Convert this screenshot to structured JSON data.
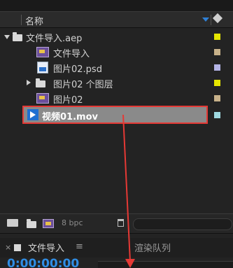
{
  "header": {
    "name_label": "名称"
  },
  "items": [
    {
      "label": "文件导入.aep",
      "type": "folder",
      "expanded": true,
      "color": "#e6e600"
    },
    {
      "label": "文件导入",
      "type": "composition",
      "color": "#c8b28a"
    },
    {
      "label": "图片02.psd",
      "type": "psd",
      "color": "#b4b4e6"
    },
    {
      "label": "图片02 个图层",
      "type": "folder",
      "expanded": false,
      "color": "#e6e600"
    },
    {
      "label": "图片02",
      "type": "composition",
      "color": "#c8b28a"
    },
    {
      "label": "视频01.mov",
      "type": "movie",
      "color": "#9fd9e0",
      "selected": true
    }
  ],
  "bottom": {
    "bpc_label": "8 bpc"
  },
  "tabs": {
    "active_label": "文件导入",
    "menu_glyph": "≡",
    "inactive_label": "渲染队列",
    "close_glyph": "×"
  },
  "timeline": {
    "timecode": "0:00:00:00"
  },
  "annotation": {
    "arrow_color": "#e53935"
  }
}
